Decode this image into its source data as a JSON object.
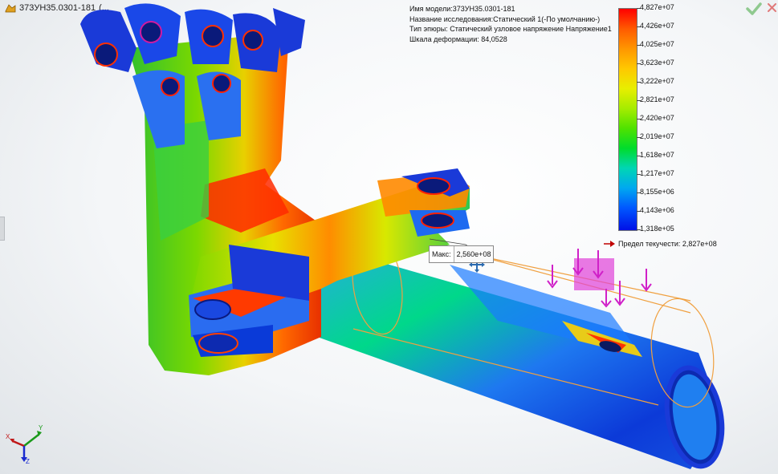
{
  "tree": {
    "part_name": "373УН35.0301-181",
    "suffix": "(...",
    "icon": "part-icon"
  },
  "study_info": {
    "model_name": "Имя модели:373УН35.0301-181",
    "study_name": "Название исследования:Статический 1(-По умолчанию-)",
    "plot_type": "Тип эпюры: Статический узловое напряжение Напряжение1",
    "deformation_scale": "Шкала деформации: 84,0528"
  },
  "legend": {
    "colors": [
      "#ff0000",
      "#ffc800",
      "#4fe200",
      "#00d6b4",
      "#0010e6"
    ],
    "labels": [
      "4,827e+07",
      "4,426e+07",
      "4,025e+07",
      "3,623e+07",
      "3,222e+07",
      "2,821e+07",
      "2,420e+07",
      "2,019e+07",
      "1,618e+07",
      "1,217e+07",
      "8,155e+06",
      "4,143e+06",
      "1,318e+05"
    ]
  },
  "yield_strength": "Предел текучести: 2,827e+08",
  "max_probe": {
    "label": "Макс:",
    "value": "2,560e+08"
  },
  "icons": {
    "ok": "check-mark-icon",
    "close": "close-icon",
    "triad": "axis-triad-icon",
    "cursor": "move-cursor-icon"
  },
  "triad_labels": {
    "x": "X",
    "y": "Y",
    "z": "Z"
  }
}
